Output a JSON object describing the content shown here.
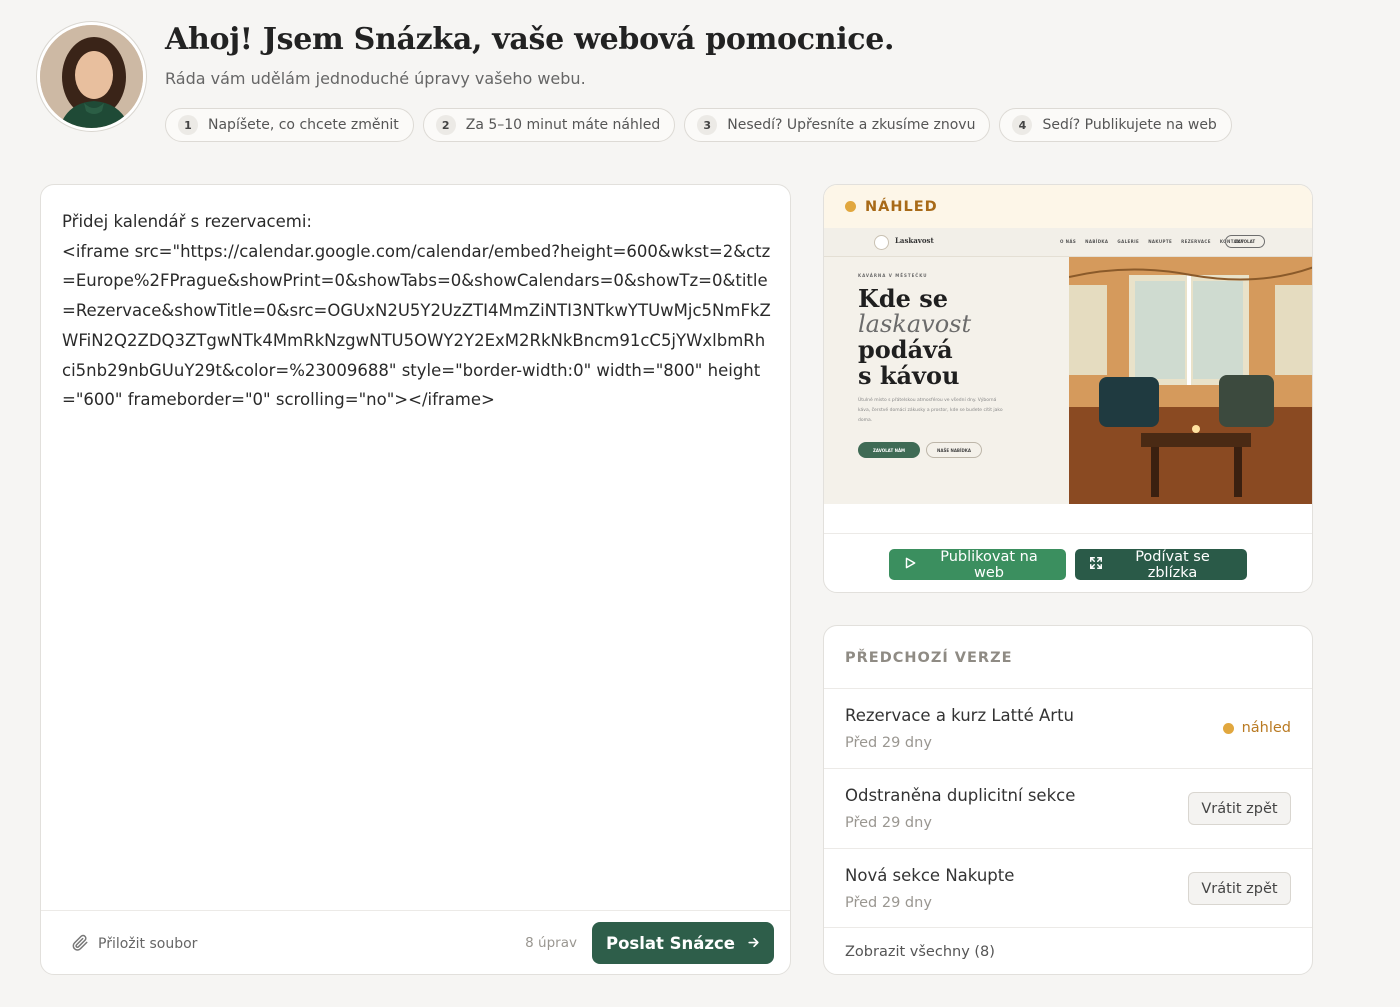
{
  "header": {
    "title": "Ahoj! Jsem Snázka, vaše webová pomocnice.",
    "subtitle": "Ráda vám udělám jednoduché úpravy vašeho webu.",
    "steps": [
      {
        "num": "1",
        "label": "Napíšete, co chcete změnit"
      },
      {
        "num": "2",
        "label": "Za 5–10 minut máte náhled"
      },
      {
        "num": "3",
        "label": "Nesedí? Upřesníte a zkusíme znovu"
      },
      {
        "num": "4",
        "label": "Sedí? Publikujete na web"
      }
    ]
  },
  "editor": {
    "text": "Přidej kalendář s rezervacemi:\n<iframe src=\"https://calendar.google.com/calendar/embed?height=600&wkst=2&ctz=Europe%2FPrague&showPrint=0&showTabs=0&showCalendars=0&showTz=0&title=Rezervace&showTitle=0&src=OGUxN2U5Y2UzZTI4MmZiNTI3NTkwYTUwMjc5NmFkZWFiN2Q2ZDQ3ZTgwNTk4MmRkNzgwNTU5OWY2Y2ExM2RkNkBncm91cC5jYWxlbmRhci5nb29nbGUuY29t&color=%23009688\" style=\"border-width:0\" width=\"800\" height=\"600\" frameborder=\"0\" scrolling=\"no\"></iframe>",
    "attach_label": "Přiložit soubor",
    "edits_count": "8 úprav",
    "send_label": "Poslat Snázce"
  },
  "preview": {
    "label": "NÁHLED",
    "site": {
      "logo": "Laskavost",
      "menu": [
        "O NÁS",
        "NABÍDKA",
        "GALERIE",
        "NAKUPTE",
        "REZERVACE",
        "KONTAKT"
      ],
      "call": "ZAVOLAT",
      "eyebrow": "KAVÁRNA V MĚSTEČKU",
      "h1_line1": "Kde se",
      "h1_line2": "laskavost",
      "h1_line3": "podává",
      "h1_line4": "s kávou",
      "paragraph": "Útulné místo s přátelskou atmosférou ve všední dny. Výborná káva, čerstvé domácí zákusky a prostor, kde se budete cítit jako doma.",
      "btn_call": "ZAVOLAT NÁM",
      "btn_menu": "NAŠE NABÍDKA"
    },
    "publish_label": "Publikovat na web",
    "zoom_label": "Podívat se zblízka"
  },
  "versions": {
    "title": "PŘEDCHOZÍ VERZE",
    "items": [
      {
        "title": "Rezervace a kurz Latté Artu",
        "time": "Před 29 dny",
        "status": "náhled"
      },
      {
        "title": "Odstraněna duplicitní sekce",
        "time": "Před 29 dny",
        "action": "Vrátit zpět"
      },
      {
        "title": "Nová sekce Nakupte",
        "time": "Před 29 dny",
        "action": "Vrátit zpět"
      }
    ],
    "show_all": "Zobrazit všechny (8)"
  },
  "colors": {
    "accent": "#2e5e4a",
    "publish": "#3b8f5f",
    "preview_status": "#e1a73e",
    "background": "#f6f5f3"
  }
}
